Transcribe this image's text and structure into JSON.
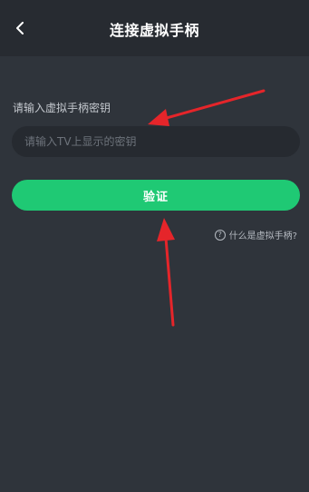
{
  "header": {
    "title": "连接虚拟手柄",
    "back_icon": "chevron-left-icon"
  },
  "form": {
    "label": "请输入虚拟手柄密钥",
    "placeholder": "请输入TV上显示的密钥",
    "value": "",
    "submit_label": "验证"
  },
  "help": {
    "icon": "question-circle-icon",
    "icon_glyph": "?",
    "text": "什么是虚拟手柄?"
  },
  "colors": {
    "background": "#2f343b",
    "header": "#272b31",
    "accent": "#1fc974",
    "annotation_arrow": "#e5252a"
  }
}
